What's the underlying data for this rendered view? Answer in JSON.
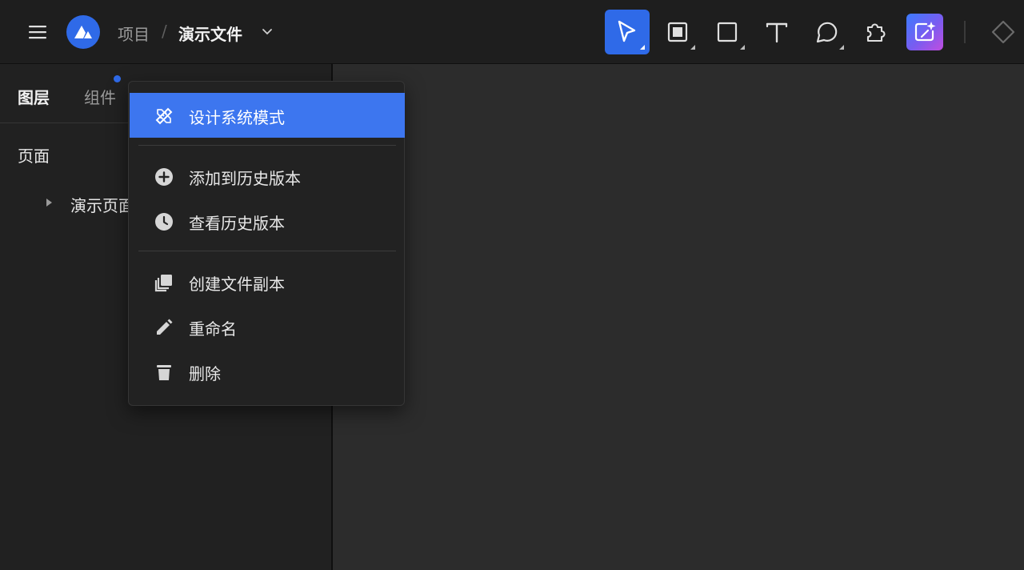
{
  "header": {
    "breadcrumb_project": "项目",
    "breadcrumb_separator": "/",
    "file_name": "演示文件",
    "icons": [
      "hamburger-menu-icon",
      "app-logo-icon",
      "chevron-down-icon"
    ]
  },
  "toolbar": {
    "tools": [
      {
        "name": "select-tool",
        "icon": "cursor-arrow-icon",
        "active": true
      },
      {
        "name": "frame-tool",
        "icon": "frame-icon",
        "active": false
      },
      {
        "name": "rectangle-tool",
        "icon": "rectangle-icon",
        "active": false
      },
      {
        "name": "text-tool",
        "icon": "text-t-icon",
        "active": false
      },
      {
        "name": "comment-tool",
        "icon": "speech-bubble-icon",
        "active": false
      },
      {
        "name": "plugins-tool",
        "icon": "puzzle-piece-icon",
        "active": false
      },
      {
        "name": "ai-assistant",
        "icon": "ai-sparkle-icon",
        "active": false
      },
      {
        "name": "component-diamond",
        "icon": "diamond-icon",
        "active": false
      }
    ],
    "accent_color": "#2f6ae8"
  },
  "left_panel": {
    "tabs": [
      {
        "label": "图层",
        "active": true
      },
      {
        "label": "组件",
        "active": false,
        "has_notification_dot": true
      }
    ],
    "pages_title": "页面",
    "pages": [
      {
        "name": "演示页面"
      }
    ]
  },
  "context_menu": {
    "items": [
      {
        "label": "设计系统模式",
        "icon": "pencil-ruler-icon",
        "highlighted": true
      },
      {
        "label": "添加到历史版本",
        "icon": "plus-circle-icon"
      },
      {
        "label": "查看历史版本",
        "icon": "clock-icon"
      },
      {
        "label": "创建文件副本",
        "icon": "duplicate-icon"
      },
      {
        "label": "重命名",
        "icon": "pencil-icon"
      },
      {
        "label": "删除",
        "icon": "trash-icon"
      }
    ],
    "highlight_color": "#3d76ef"
  },
  "colors": {
    "topbar_bg": "#1e1e1e",
    "panel_bg": "#212121",
    "canvas_bg": "#2c2c2c"
  }
}
